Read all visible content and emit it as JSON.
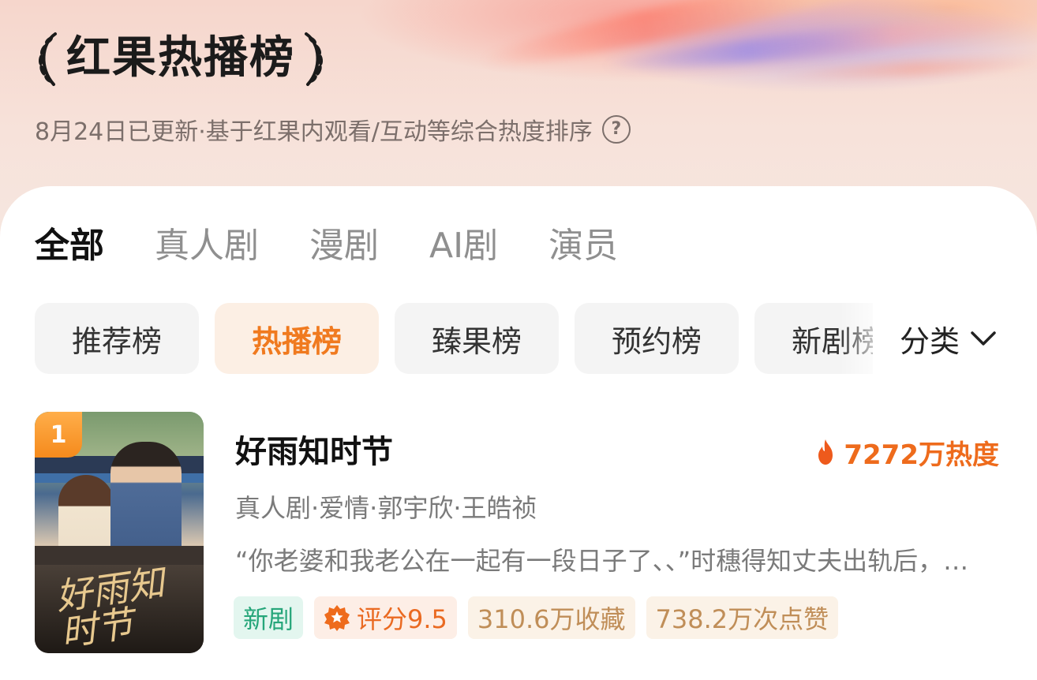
{
  "header": {
    "title": "红果热播榜",
    "subtitle": "8月24日已更新·基于红果内观看/互动等综合热度排序",
    "help_icon": "question-circle-icon"
  },
  "tabs": [
    {
      "label": "全部",
      "active": true
    },
    {
      "label": "真人剧",
      "active": false
    },
    {
      "label": "漫剧",
      "active": false
    },
    {
      "label": "AI剧",
      "active": false
    },
    {
      "label": "演员",
      "active": false
    }
  ],
  "rank_chips": [
    {
      "label": "推荐榜",
      "active": false
    },
    {
      "label": "热播榜",
      "active": true
    },
    {
      "label": "臻果榜",
      "active": false
    },
    {
      "label": "预约榜",
      "active": false
    },
    {
      "label": "新剧榜",
      "active": false
    }
  ],
  "filter": {
    "label": "分类",
    "icon": "chevron-down-icon"
  },
  "items": [
    {
      "rank": "1",
      "title": "好雨知时节",
      "heat": "7272万热度",
      "meta": "真人剧·爱情·郭宇欣·王皓祯",
      "description": "“你老婆和我老公在一起有一段日子了、、”时穗得知丈夫出轨后，果断离婚",
      "poster_title": "好雨知时节",
      "tags": {
        "new": "新剧",
        "rating": "评分9.5",
        "favorites": "310.6万收藏",
        "likes": "738.2万次点赞"
      }
    }
  ],
  "colors": {
    "accent": "#f07a1f",
    "heat": "#ee6b1c",
    "new_tag": "#26a67a",
    "muted_text": "#7a7a7a"
  }
}
